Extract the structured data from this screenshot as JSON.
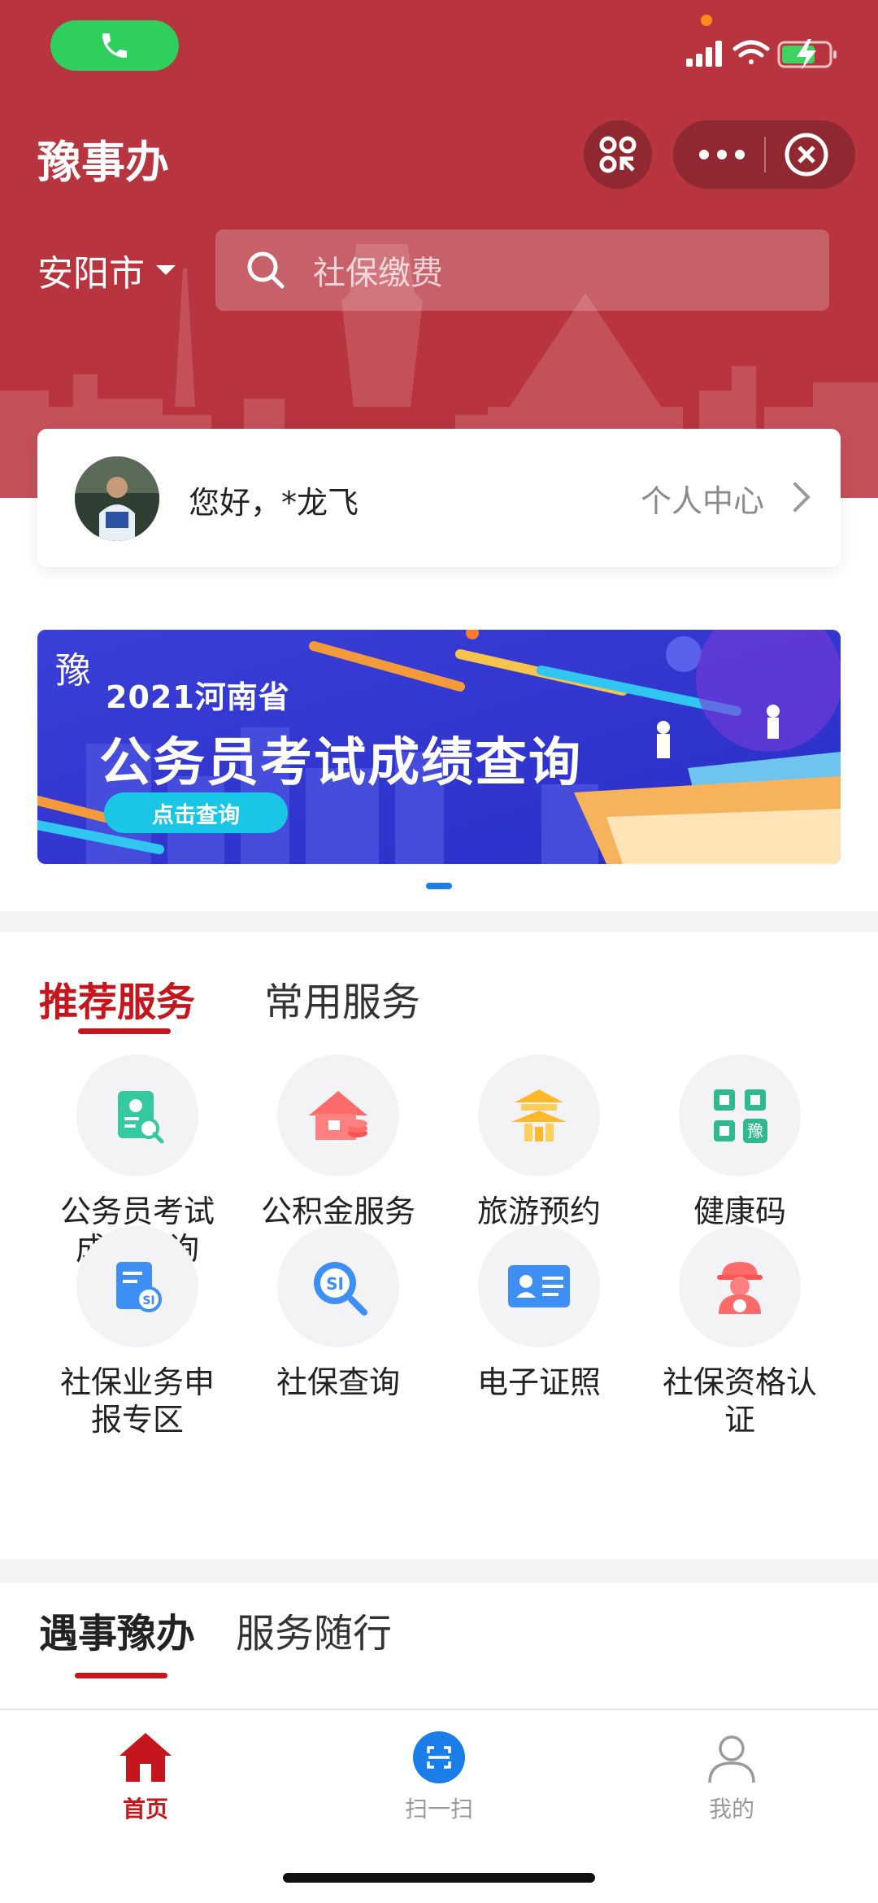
{
  "app": {
    "title": "豫事办"
  },
  "location": {
    "city": "安阳市"
  },
  "search": {
    "placeholder": "社保缴费"
  },
  "user": {
    "greeting": "您好，*龙飞",
    "center_link": "个人中心"
  },
  "banner": {
    "line1": "2021河南省",
    "line2": "公务员考试成绩查询",
    "button": "点击查询",
    "logo": "豫"
  },
  "services": {
    "tabs": [
      {
        "label": "推荐服务",
        "active": true
      },
      {
        "label": "常用服务",
        "active": false
      }
    ],
    "items": [
      {
        "label": "公务员考试\n成绩查询",
        "icon": "exam-score-icon"
      },
      {
        "label": "公积金服务",
        "icon": "house-fund-icon"
      },
      {
        "label": "旅游预约",
        "icon": "pagoda-icon"
      },
      {
        "label": "健康码",
        "icon": "qr-health-icon"
      },
      {
        "label": "社保业务申\n报专区",
        "icon": "si-document-icon"
      },
      {
        "label": "社保查询",
        "icon": "si-search-icon"
      },
      {
        "label": "电子证照",
        "icon": "id-card-icon"
      },
      {
        "label": "社保资格认\n证",
        "icon": "si-certification-icon"
      }
    ]
  },
  "section2": {
    "tabs": [
      {
        "label": "遇事豫办",
        "active": true
      },
      {
        "label": "服务随行",
        "active": false
      }
    ]
  },
  "tabbar": {
    "items": [
      {
        "label": "首页",
        "active": true,
        "icon": "home-icon"
      },
      {
        "label": "扫一扫",
        "active": false,
        "icon": "scan-icon"
      },
      {
        "label": "我的",
        "active": false,
        "icon": "user-icon"
      }
    ]
  },
  "colors": {
    "brand_red": "#b8343f",
    "accent_red": "#c4161c",
    "accent_blue": "#1a7de8"
  }
}
